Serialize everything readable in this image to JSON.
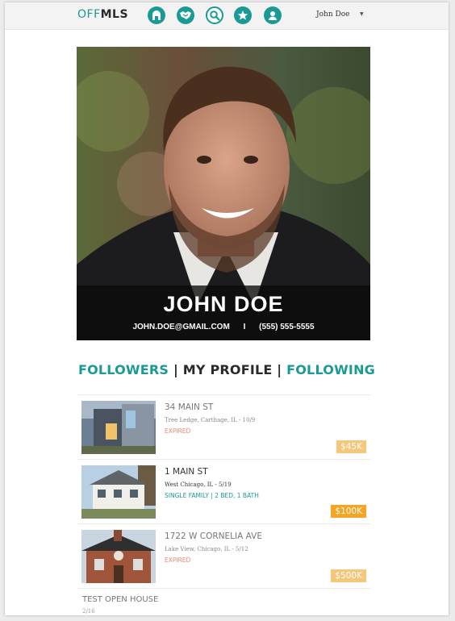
{
  "app": {
    "logo_off": "OFF",
    "logo_mls": "MLS",
    "user_name": "John Doe"
  },
  "nav_icons": [
    "house-icon",
    "handshake-icon",
    "search-icon",
    "star-icon",
    "user-icon"
  ],
  "profile": {
    "name": "JOHN DOE",
    "email": "JOHN.DOE@GMAIL.COM",
    "separator": "I",
    "phone": "(555) 555-5555"
  },
  "tabs": {
    "followers": "FOLLOWERS",
    "sep1": "|",
    "my_profile": "MY PROFILE",
    "sep2": "|",
    "following": "FOLLOWING"
  },
  "listings": [
    {
      "address": "34 MAIN ST",
      "location": "Tree Ledge, Carthage, IL  -  10/9",
      "status": "EXPIRED",
      "price": "$45K"
    },
    {
      "address": "1 MAIN ST",
      "location": "West Chicago, IL  -  5/19",
      "status": "SINGLE FAMILY | 2 BED, 1 BATH",
      "price": "$100K"
    },
    {
      "address": "1722 W CORNELIA AVE",
      "location": "Lake View, Chicago, IL  -  5/12",
      "status": "EXPIRED",
      "price": "$500K"
    }
  ],
  "open_house": {
    "title": "TEST OPEN HOUSE",
    "date": "2/16"
  },
  "colors": {
    "accent": "#1a9a95",
    "price": "#f5a524",
    "expired": "#e88b77"
  }
}
